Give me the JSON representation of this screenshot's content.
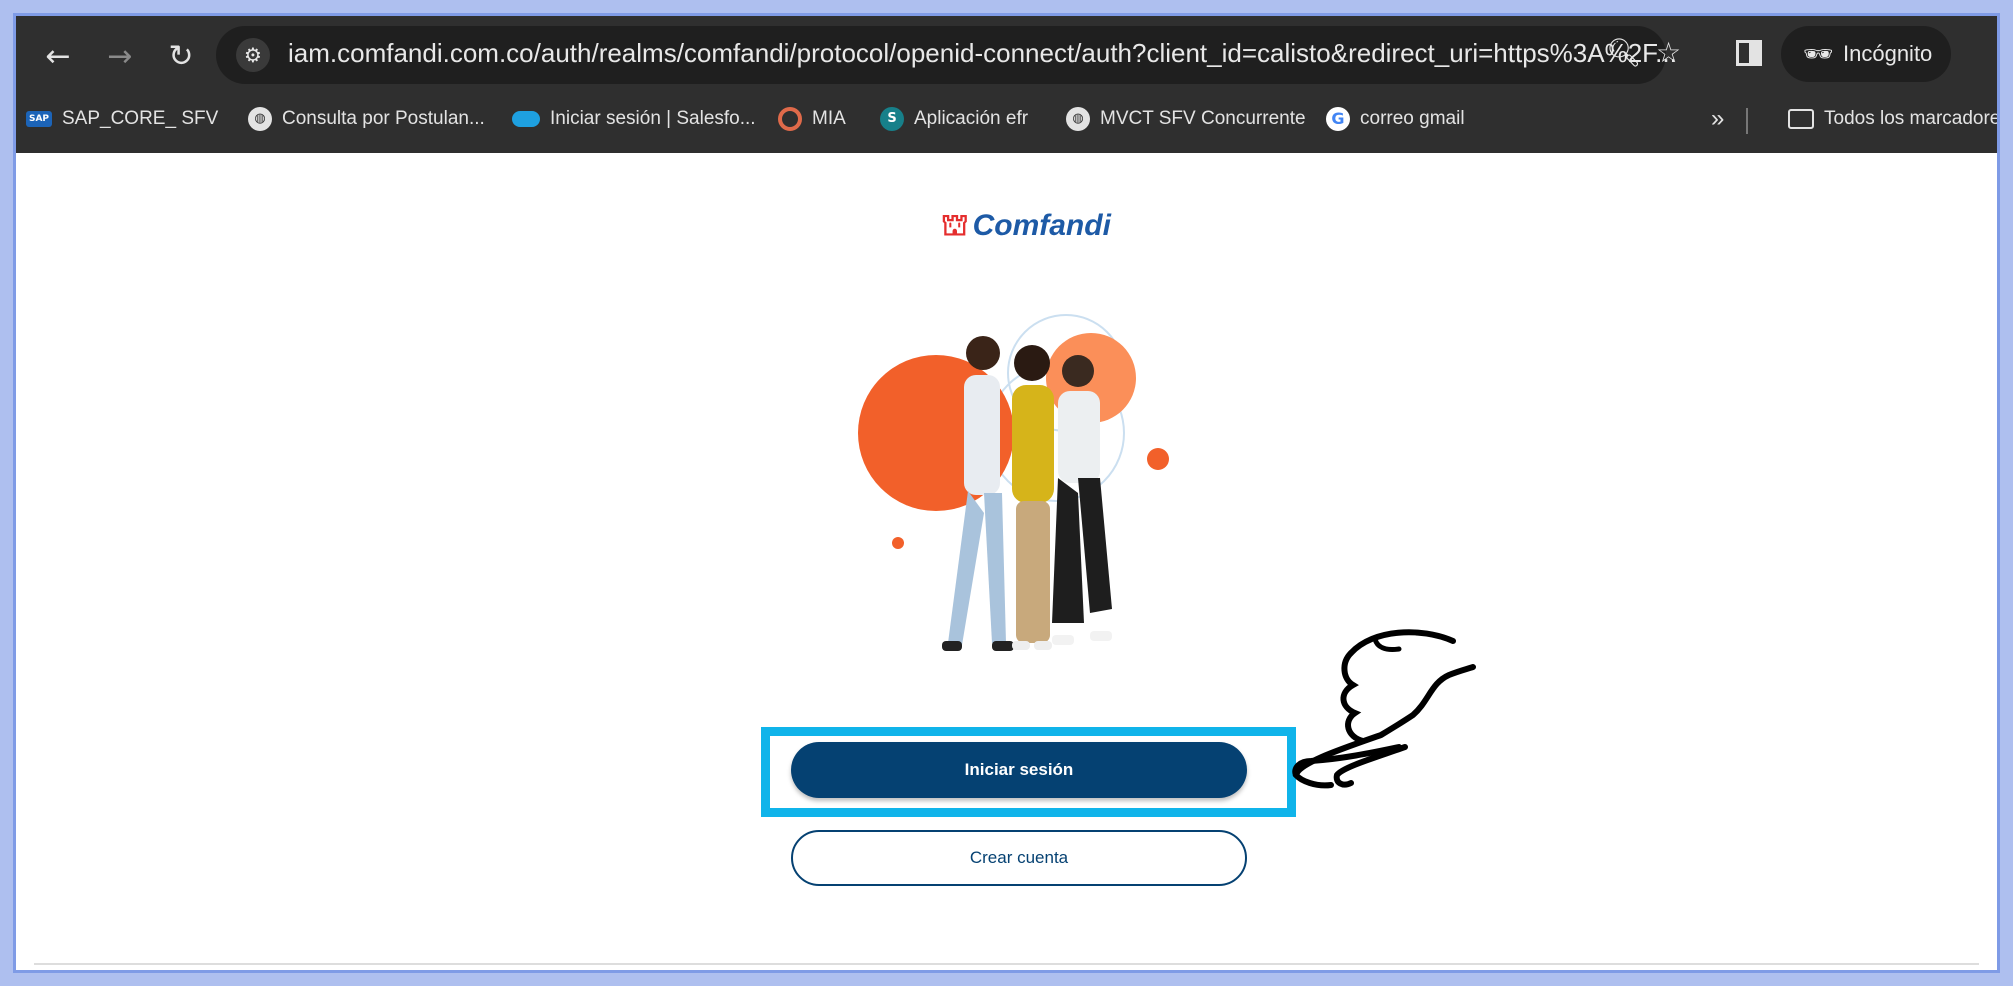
{
  "browser": {
    "url": "iam.comfandi.com.co/auth/realms/comfandi/protocol/openid-connect/auth?client_id=calisto&redirect_uri=https%3A%2F...",
    "incognito_label": "Incógnito",
    "bookmarks": [
      {
        "label": "SAP_CORE_ SFV",
        "icon": "sap-icon"
      },
      {
        "label": "Consulta por Postulan...",
        "icon": "globe-icon"
      },
      {
        "label": "Iniciar sesión | Salesfo...",
        "icon": "salesforce-cloud-icon"
      },
      {
        "label": "MIA",
        "icon": "mia-icon"
      },
      {
        "label": "Aplicación efr",
        "icon": "sharepoint-icon"
      },
      {
        "label": "MVCT SFV Concurrente",
        "icon": "globe-icon"
      },
      {
        "label": "correo gmail",
        "icon": "google-icon"
      }
    ],
    "overflow_label": "»",
    "all_bookmarks_label": "Todos los marcadores"
  },
  "page": {
    "logo_text": "Comfandi",
    "login_button": "Iniciar sesión",
    "create_account_button": "Crear cuenta"
  },
  "colors": {
    "primary": "#054172",
    "highlight": "#10b4ea",
    "logo_blue": "#1d5aa6",
    "accent_orange": "#f2602a"
  }
}
